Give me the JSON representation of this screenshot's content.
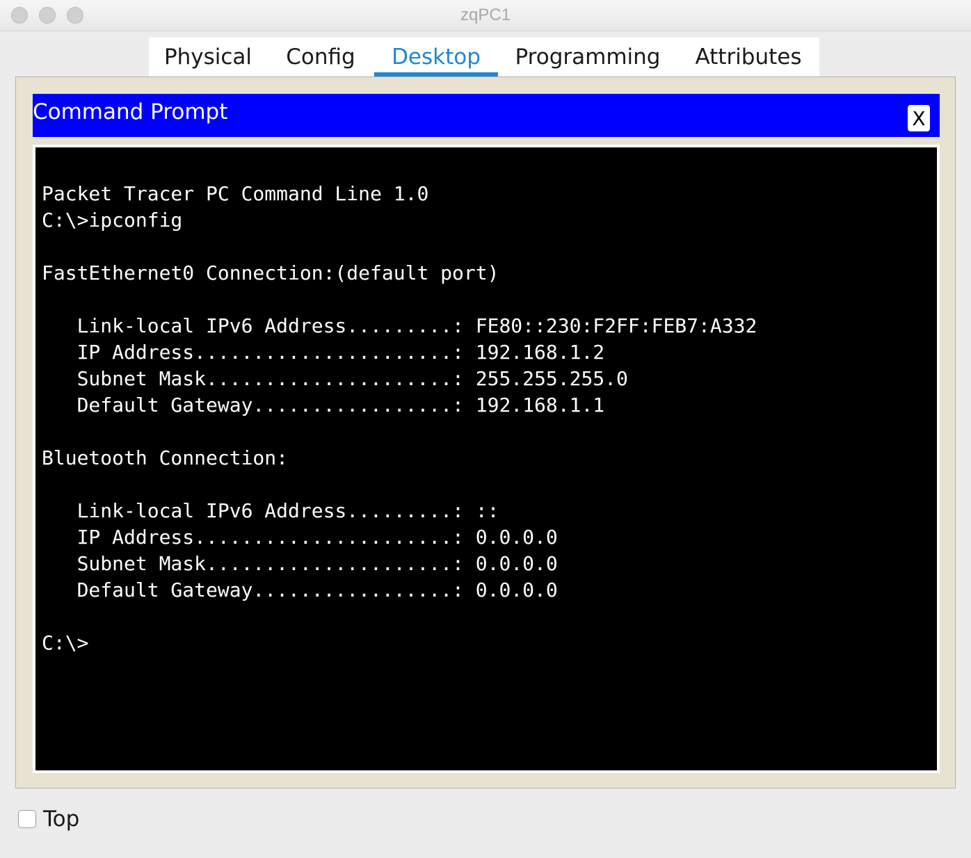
{
  "window": {
    "title": "zqPC1"
  },
  "tabs": [
    {
      "label": "Physical",
      "active": false
    },
    {
      "label": "Config",
      "active": false
    },
    {
      "label": "Desktop",
      "active": true
    },
    {
      "label": "Programming",
      "active": false
    },
    {
      "label": "Attributes",
      "active": false
    }
  ],
  "command_prompt": {
    "title": "Command Prompt",
    "close_label": "X",
    "output": "Packet Tracer PC Command Line 1.0\nC:\\>ipconfig\n\nFastEthernet0 Connection:(default port)\n\n   Link-local IPv6 Address.........: FE80::230:F2FF:FEB7:A332\n   IP Address......................: 192.168.1.2\n   Subnet Mask.....................: 255.255.255.0\n   Default Gateway.................: 192.168.1.1\n\nBluetooth Connection:\n\n   Link-local IPv6 Address.........: ::\n   IP Address......................: 0.0.0.0\n   Subnet Mask.....................: 0.0.0.0\n   Default Gateway.................: 0.0.0.0\n\nC:\\>"
  },
  "footer": {
    "top_label": "Top",
    "top_checked": false
  },
  "colors": {
    "accent": "#1f88d1",
    "cmd_header": "#0000ff",
    "panel": "#e8e2d2",
    "terminal_bg": "#000000",
    "terminal_fg": "#ffffff"
  }
}
